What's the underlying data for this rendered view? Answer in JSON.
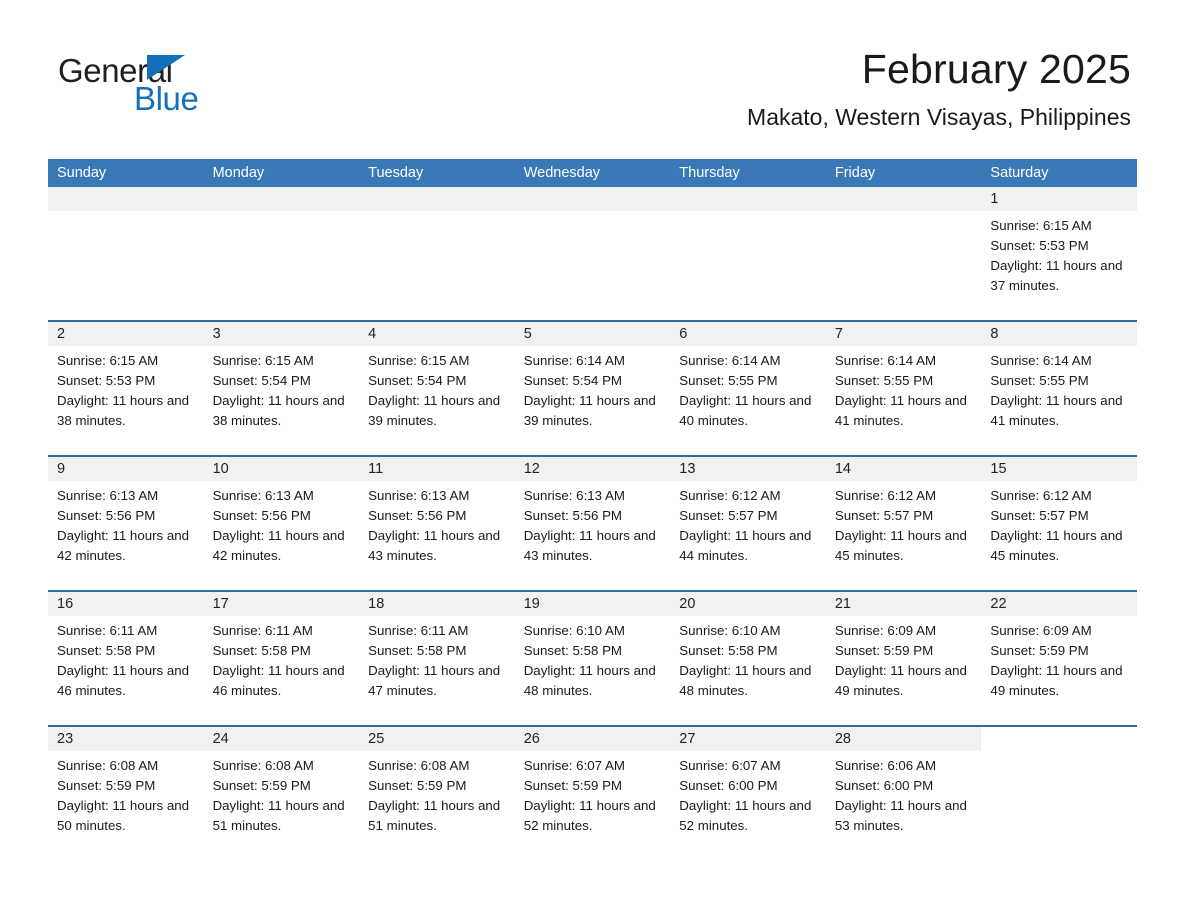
{
  "brand": {
    "name_top": "General",
    "name_bottom": "Blue",
    "accent_color": "#1271b8"
  },
  "header": {
    "month_title": "February 2025",
    "location": "Makato, Western Visayas, Philippines"
  },
  "theme": {
    "header_bar_color": "#3a79b8",
    "row_divider_color": "#2e6da4",
    "daynum_band_color": "#f1f1f1",
    "text_color": "#1a1a1a"
  },
  "weekdays": [
    "Sunday",
    "Monday",
    "Tuesday",
    "Wednesday",
    "Thursday",
    "Friday",
    "Saturday"
  ],
  "labels": {
    "sunrise_prefix": "Sunrise:",
    "sunset_prefix": "Sunset:",
    "daylight_prefix": "Daylight:"
  },
  "weeks": [
    {
      "days": [
        {
          "empty": true
        },
        {
          "empty": true
        },
        {
          "empty": true
        },
        {
          "empty": true
        },
        {
          "empty": true
        },
        {
          "empty": true
        },
        {
          "day": "1",
          "sunrise": "Sunrise: 6:15 AM",
          "sunset": "Sunset: 5:53 PM",
          "daylight": "Daylight: 11 hours and 37 minutes."
        }
      ]
    },
    {
      "days": [
        {
          "day": "2",
          "sunrise": "Sunrise: 6:15 AM",
          "sunset": "Sunset: 5:53 PM",
          "daylight": "Daylight: 11 hours and 38 minutes."
        },
        {
          "day": "3",
          "sunrise": "Sunrise: 6:15 AM",
          "sunset": "Sunset: 5:54 PM",
          "daylight": "Daylight: 11 hours and 38 minutes."
        },
        {
          "day": "4",
          "sunrise": "Sunrise: 6:15 AM",
          "sunset": "Sunset: 5:54 PM",
          "daylight": "Daylight: 11 hours and 39 minutes."
        },
        {
          "day": "5",
          "sunrise": "Sunrise: 6:14 AM",
          "sunset": "Sunset: 5:54 PM",
          "daylight": "Daylight: 11 hours and 39 minutes."
        },
        {
          "day": "6",
          "sunrise": "Sunrise: 6:14 AM",
          "sunset": "Sunset: 5:55 PM",
          "daylight": "Daylight: 11 hours and 40 minutes."
        },
        {
          "day": "7",
          "sunrise": "Sunrise: 6:14 AM",
          "sunset": "Sunset: 5:55 PM",
          "daylight": "Daylight: 11 hours and 41 minutes."
        },
        {
          "day": "8",
          "sunrise": "Sunrise: 6:14 AM",
          "sunset": "Sunset: 5:55 PM",
          "daylight": "Daylight: 11 hours and 41 minutes."
        }
      ]
    },
    {
      "days": [
        {
          "day": "9",
          "sunrise": "Sunrise: 6:13 AM",
          "sunset": "Sunset: 5:56 PM",
          "daylight": "Daylight: 11 hours and 42 minutes."
        },
        {
          "day": "10",
          "sunrise": "Sunrise: 6:13 AM",
          "sunset": "Sunset: 5:56 PM",
          "daylight": "Daylight: 11 hours and 42 minutes."
        },
        {
          "day": "11",
          "sunrise": "Sunrise: 6:13 AM",
          "sunset": "Sunset: 5:56 PM",
          "daylight": "Daylight: 11 hours and 43 minutes."
        },
        {
          "day": "12",
          "sunrise": "Sunrise: 6:13 AM",
          "sunset": "Sunset: 5:56 PM",
          "daylight": "Daylight: 11 hours and 43 minutes."
        },
        {
          "day": "13",
          "sunrise": "Sunrise: 6:12 AM",
          "sunset": "Sunset: 5:57 PM",
          "daylight": "Daylight: 11 hours and 44 minutes."
        },
        {
          "day": "14",
          "sunrise": "Sunrise: 6:12 AM",
          "sunset": "Sunset: 5:57 PM",
          "daylight": "Daylight: 11 hours and 45 minutes."
        },
        {
          "day": "15",
          "sunrise": "Sunrise: 6:12 AM",
          "sunset": "Sunset: 5:57 PM",
          "daylight": "Daylight: 11 hours and 45 minutes."
        }
      ]
    },
    {
      "days": [
        {
          "day": "16",
          "sunrise": "Sunrise: 6:11 AM",
          "sunset": "Sunset: 5:58 PM",
          "daylight": "Daylight: 11 hours and 46 minutes."
        },
        {
          "day": "17",
          "sunrise": "Sunrise: 6:11 AM",
          "sunset": "Sunset: 5:58 PM",
          "daylight": "Daylight: 11 hours and 46 minutes."
        },
        {
          "day": "18",
          "sunrise": "Sunrise: 6:11 AM",
          "sunset": "Sunset: 5:58 PM",
          "daylight": "Daylight: 11 hours and 47 minutes."
        },
        {
          "day": "19",
          "sunrise": "Sunrise: 6:10 AM",
          "sunset": "Sunset: 5:58 PM",
          "daylight": "Daylight: 11 hours and 48 minutes."
        },
        {
          "day": "20",
          "sunrise": "Sunrise: 6:10 AM",
          "sunset": "Sunset: 5:58 PM",
          "daylight": "Daylight: 11 hours and 48 minutes."
        },
        {
          "day": "21",
          "sunrise": "Sunrise: 6:09 AM",
          "sunset": "Sunset: 5:59 PM",
          "daylight": "Daylight: 11 hours and 49 minutes."
        },
        {
          "day": "22",
          "sunrise": "Sunrise: 6:09 AM",
          "sunset": "Sunset: 5:59 PM",
          "daylight": "Daylight: 11 hours and 49 minutes."
        }
      ]
    },
    {
      "days": [
        {
          "day": "23",
          "sunrise": "Sunrise: 6:08 AM",
          "sunset": "Sunset: 5:59 PM",
          "daylight": "Daylight: 11 hours and 50 minutes."
        },
        {
          "day": "24",
          "sunrise": "Sunrise: 6:08 AM",
          "sunset": "Sunset: 5:59 PM",
          "daylight": "Daylight: 11 hours and 51 minutes."
        },
        {
          "day": "25",
          "sunrise": "Sunrise: 6:08 AM",
          "sunset": "Sunset: 5:59 PM",
          "daylight": "Daylight: 11 hours and 51 minutes."
        },
        {
          "day": "26",
          "sunrise": "Sunrise: 6:07 AM",
          "sunset": "Sunset: 5:59 PM",
          "daylight": "Daylight: 11 hours and 52 minutes."
        },
        {
          "day": "27",
          "sunrise": "Sunrise: 6:07 AM",
          "sunset": "Sunset: 6:00 PM",
          "daylight": "Daylight: 11 hours and 52 minutes."
        },
        {
          "day": "28",
          "sunrise": "Sunrise: 6:06 AM",
          "sunset": "Sunset: 6:00 PM",
          "daylight": "Daylight: 11 hours and 53 minutes."
        },
        {
          "empty": true
        }
      ]
    }
  ]
}
